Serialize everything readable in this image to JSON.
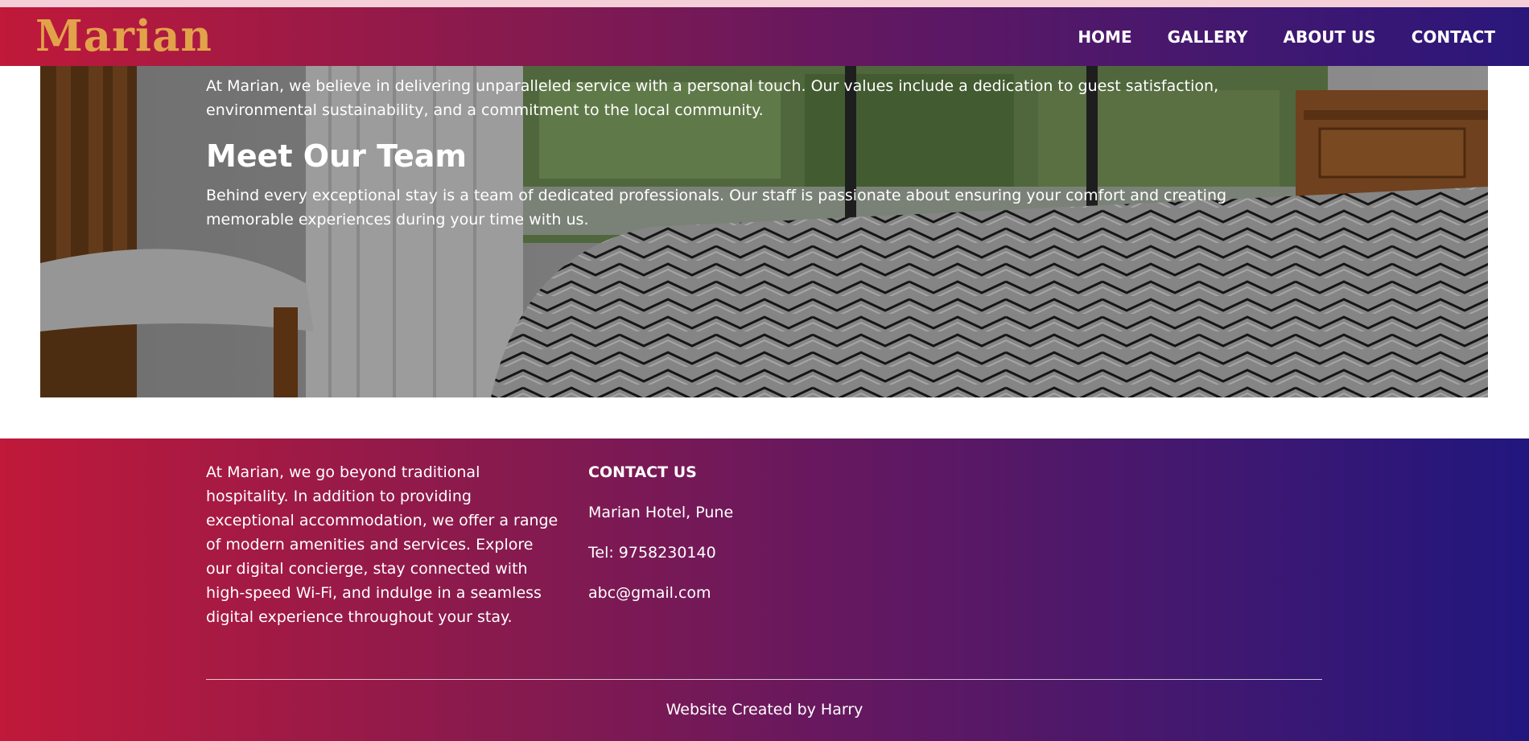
{
  "brand": {
    "logo_text": "Marian",
    "logo_color": "#e2a24a"
  },
  "nav": {
    "items": [
      {
        "label": "HOME"
      },
      {
        "label": "GALLERY"
      },
      {
        "label": "ABOUT US"
      },
      {
        "label": "CONTACT"
      }
    ]
  },
  "hero": {
    "values_text": "At Marian, we believe in delivering unparalleled service with a personal touch. Our values include a dedication to guest satisfaction, environmental sustainability, and a commitment to the local community.",
    "team_title": "Meet Our Team",
    "team_text": "Behind every exceptional stay is a team of dedicated professionals. Our staff is passionate about ensuring your comfort and creating memorable experiences during your time with us."
  },
  "footer": {
    "about_text": "At Marian, we go beyond traditional hospitality. In addition to providing exceptional accommodation, we offer a range of modern amenities and services. Explore our digital concierge, stay connected with high-speed Wi-Fi, and indulge in a seamless digital experience throughout your stay.",
    "contact_heading": "CONTACT US",
    "address": "Marian Hotel, Pune",
    "phone": "Tel: 9758230140",
    "email": "abc@gmail.com",
    "credit": "Website Created by Harry"
  },
  "colors": {
    "gradient_start": "#c0193a",
    "gradient_end": "#21177e",
    "accent": "#e2a24a"
  }
}
